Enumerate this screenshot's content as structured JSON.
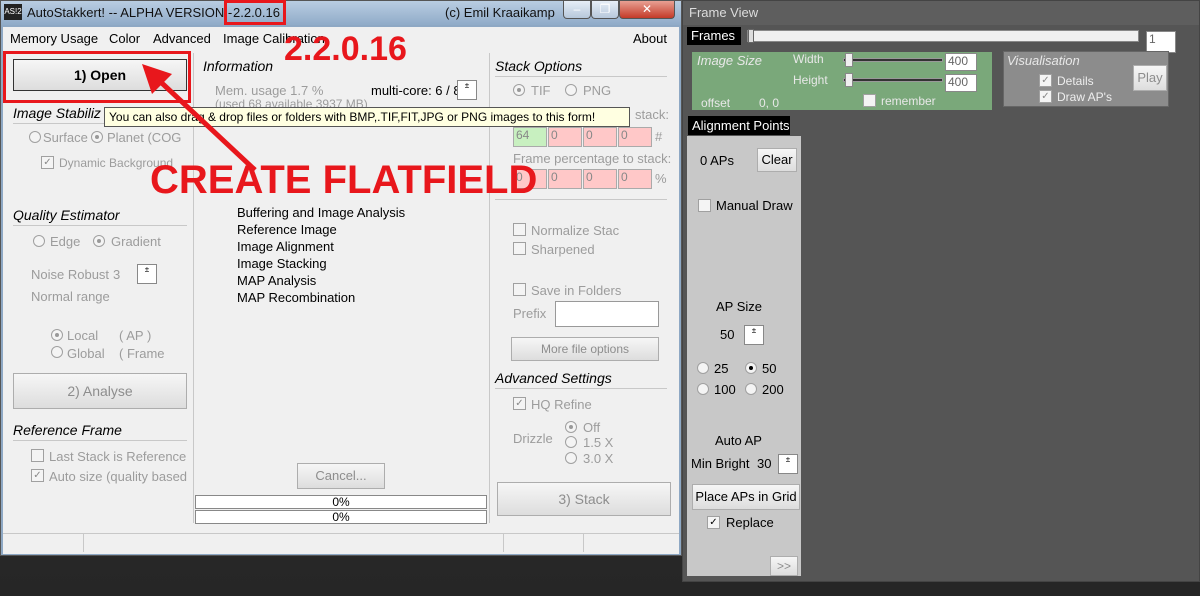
{
  "main_window": {
    "title": "AutoStakkert! -- ALPHA VERSION -",
    "version": "2.2.0.16",
    "author": "(c) Emil Kraaikamp",
    "app_icon": "AS!2",
    "controls": {
      "minimize": "–",
      "maximize": "❐",
      "close": "✕"
    }
  },
  "menu": {
    "items": [
      "Memory Usage",
      "Color",
      "Advanced",
      "Image Calibration"
    ],
    "about": "About"
  },
  "left": {
    "open_button": "1) Open",
    "image_stabilization": "Image Stabiliz",
    "surface": "Surface",
    "planet": "Planet (COG",
    "dynamic_background": "Dynamic Background",
    "quality_estimator": "Quality Estimator",
    "edge": "Edge",
    "gradient": "Gradient",
    "noise_robust_label": "Noise Robust",
    "noise_robust_value": "3",
    "normal_range": "Normal range",
    "local": "Local",
    "local_ap": "( AP )",
    "global": "Global",
    "global_frame": "( Frame",
    "analyse_button": "2) Analyse",
    "reference_frame": "Reference Frame",
    "last_stack": "Last Stack is Reference",
    "auto_size": "Auto size (quality based"
  },
  "info": {
    "heading": "Information",
    "mem_usage": "Mem. usage 1.7 %",
    "mem_detail": "(used 68 available 3937 MB)",
    "multicore": "multi-core: 6 / 8",
    "steps": [
      "Buffering and Image Analysis",
      "Reference Image",
      "Image Alignment",
      "Image Stacking",
      "MAP Analysis",
      "MAP Recombination"
    ],
    "cancel_button": "Cancel...",
    "progress1": "0%",
    "progress2": "0%"
  },
  "stack": {
    "heading": "Stack Options",
    "tif": "TIF",
    "png": "PNG",
    "frames_to_stack": "stack:",
    "frames_values": [
      "64",
      "0",
      "0",
      "0"
    ],
    "hash": "#",
    "percentage_label": "Frame percentage to stack:",
    "percent_values": [
      "0",
      "0",
      "0",
      "0"
    ],
    "percent_sign": "%",
    "normalize": "Normalize Stac",
    "sharpened": "Sharpened",
    "save_in_folders": "Save in Folders",
    "prefix": "Prefix",
    "more_file_options": "More file options",
    "advanced_settings": "Advanced Settings",
    "hq_refine": "HQ Refine",
    "drizzle": "Drizzle",
    "drizzle_off": "Off",
    "drizzle_15": "1.5 X",
    "drizzle_30": "3.0 X",
    "stack_button": "3) Stack"
  },
  "tooltip": "You can also drag & drop files or folders with BMP,.TIF,FIT,JPG or PNG images to this form!",
  "annotations": {
    "version_big": "2.2.0.16",
    "create_flatfield": "CREATE FLATFIELD",
    "color": "#e8171c"
  },
  "frame_view": {
    "title": "Frame View",
    "frames_label": "Frames",
    "frame_number": "1",
    "image_size": "Image Size",
    "width_label": "Width",
    "height_label": "Height",
    "width_value": "400",
    "height_value": "400",
    "remember": "remember",
    "offset_label": "offset",
    "offset_value": "0, 0",
    "visualisation": "Visualisation",
    "details": "Details",
    "draw_aps": "Draw AP's",
    "play_button": "Play",
    "alignment_points": "Alignment Points",
    "ap_count": "0 APs",
    "clear_button": "Clear",
    "manual_draw": "Manual Draw",
    "ap_size_label": "AP Size",
    "ap_size_value": "50",
    "sizes": [
      "25",
      "50",
      "100",
      "200"
    ],
    "auto_ap": "Auto AP",
    "min_bright_label": "Min Bright",
    "min_bright_value": "30",
    "place_grid_button": "Place APs in Grid",
    "replace": "Replace",
    "next_button": ">>"
  }
}
